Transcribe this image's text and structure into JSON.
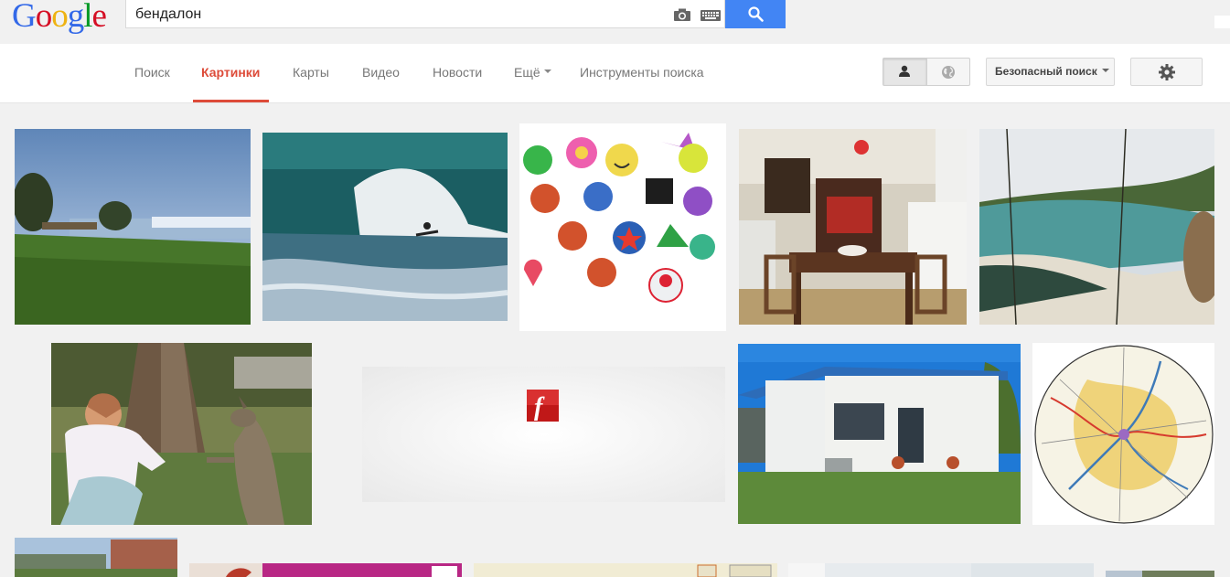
{
  "logo": {
    "letters": [
      "G",
      "o",
      "o",
      "g",
      "l",
      "e"
    ],
    "colors": [
      "#3369e8",
      "#d50f25",
      "#eeb211",
      "#3369e8",
      "#009925",
      "#d50f25"
    ]
  },
  "search": {
    "query": "бендалон",
    "camera_icon": "camera-icon",
    "keyboard_icon": "keyboard-icon",
    "search_icon": "magnifier-icon",
    "button_color": "#4285f4"
  },
  "nav": {
    "tabs": [
      {
        "label": "Поиск",
        "active": false
      },
      {
        "label": "Картинки",
        "active": true
      },
      {
        "label": "Карты",
        "active": false
      },
      {
        "label": "Видео",
        "active": false
      },
      {
        "label": "Новости",
        "active": false
      },
      {
        "label": "Ещё",
        "active": false
      },
      {
        "label": "Инструменты поиска",
        "active": false
      }
    ],
    "active_color": "#dd4b39",
    "personal_icon": "person-icon",
    "global_icon": "globe-icon",
    "safe_search_label": "Безопасный поиск",
    "settings_icon": "gear-icon"
  },
  "results": {
    "row1": [
      "beach-park-image",
      "surfing-wave-image",
      "rubber-bracelet-charms-image",
      "kitchen-dining-room-image",
      "coastal-cove-image"
    ],
    "row2": [
      "girl-feeding-kangaroo-image",
      "flash-player-placeholder-image",
      "white-cottage-image",
      "round-road-map-image"
    ],
    "row3": [
      "brick-building-image",
      "pink-banner-image",
      "wedding-card-image",
      "interior-room-image",
      "tree-photo-image"
    ],
    "flash_symbol": "f"
  }
}
